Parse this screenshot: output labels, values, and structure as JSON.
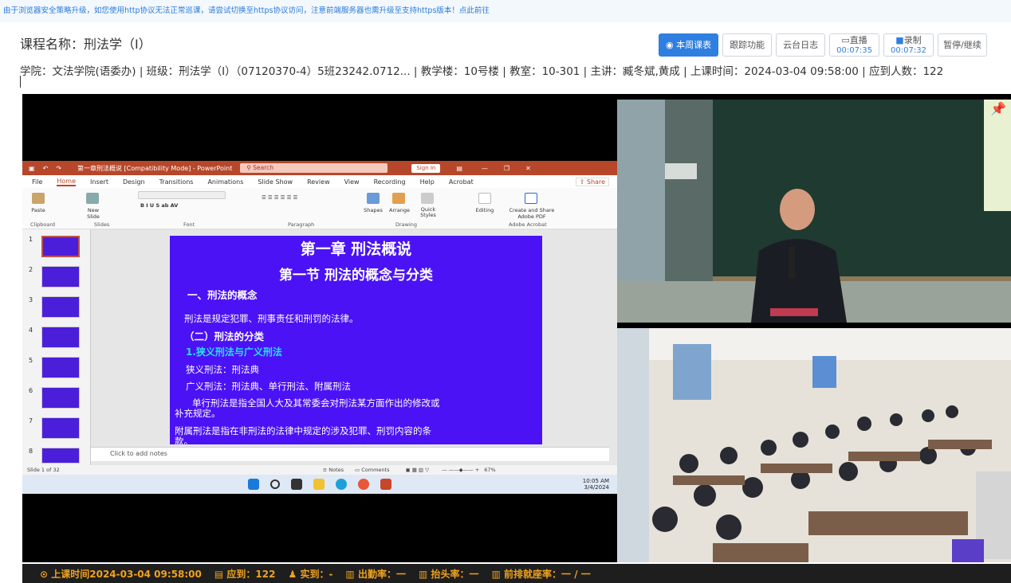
{
  "notice": "由于浏览器安全策略升级，如您使用http协议无法正常巡课，请尝试切换至https协议访问，注意前端服务器也需升级至支持https版本！点此前往",
  "course": {
    "title": "课程名称：刑法学（Ⅰ）",
    "info": "学院：文法学院(语委办) | 班级：刑法学（Ⅰ）（07120370-4）5班23242.0712... | 教学楼：10号楼 | 教室：10-301 | 主讲：臧冬斌,黄成 | 上课时间：2024-03-04 09:58:00 | 应到人数：122"
  },
  "toolbar": {
    "week_schedule": "本周课表",
    "tracking": "跟踪功能",
    "ptz_log": "云台日志",
    "live": {
      "label": "直播",
      "timer": "00:07:35"
    },
    "record": {
      "label": "录制",
      "timer": "00:07:32"
    },
    "pause": "暂停/继续"
  },
  "ppt": {
    "window_title": "第一章刑法概说 [Compatibility Mode] - PowerPoint",
    "search_placeholder": "Search",
    "sign_in": "Sign In",
    "share": "Share",
    "menu": [
      "File",
      "Home",
      "Insert",
      "Design",
      "Transitions",
      "Animations",
      "Slide Show",
      "Review",
      "View",
      "Recording",
      "Help",
      "Acrobat"
    ],
    "ribbon": {
      "paste": "Paste",
      "new_slide": "New Slide",
      "shapes": "Shapes",
      "arrange": "Arrange",
      "quick_styles": "Quick Styles",
      "editing": "Editing",
      "create_share_pdf": "Create and Share Adobe PDF",
      "groups": [
        "Clipboard",
        "Slides",
        "Font",
        "Paragraph",
        "Drawing",
        "Adobe Acrobat"
      ]
    },
    "thumbnails": [
      "1",
      "2",
      "3",
      "4",
      "5",
      "6",
      "7",
      "8"
    ],
    "slide": {
      "title": "第一章 刑法概说",
      "subtitle": "第一节  刑法的概念与分类",
      "l1": "一、刑法的概念",
      "l2": "刑法是规定犯罪、刑事责任和刑罚的法律。",
      "l3": "（二）刑法的分类",
      "l4": "1.狭义刑法与广义刑法",
      "l5": "狭义刑法：刑法典",
      "l6": "广义刑法：刑法典、单行刑法、附属刑法",
      "l7": "单行刑法是指全国人大及其常委会对刑法某方面作出的修改或",
      "l7b": "补充规定。",
      "l8": "附属刑法是指在非刑法的法律中规定的涉及犯罪、刑罚内容的条",
      "l8b": "款。"
    },
    "notes_placeholder": "Click to add notes",
    "status": {
      "slide_count": "Slide 1 of 32",
      "notes": "Notes",
      "comments": "Comments",
      "zoom": "67%"
    },
    "clock": {
      "time": "10:05 AM",
      "date": "3/4/2024"
    }
  },
  "stats": {
    "start_time": "上课时间2024-03-04  09:58:00",
    "expected": "应到：122",
    "actual": "实到：-",
    "attendance": "出勤率：一",
    "head_up": "抬头率：一",
    "front_seat": "前排就座率：一 / 一"
  },
  "colors": {
    "accent": "#2f7fe0",
    "ppt_red": "#b7472a",
    "slide_bg": "#4b12f5",
    "stats_text": "#f0a21e"
  }
}
